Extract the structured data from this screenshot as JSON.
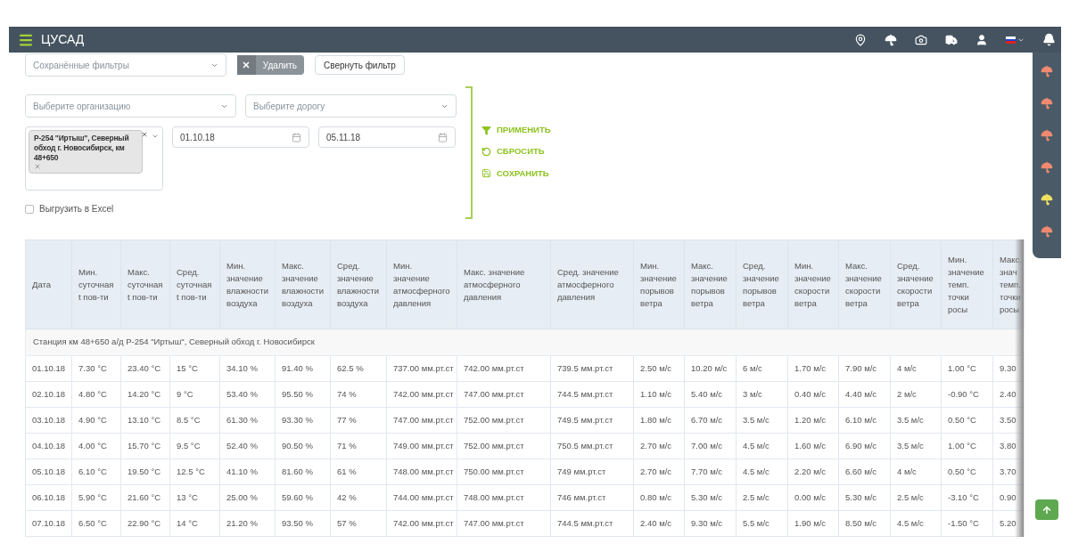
{
  "header": {
    "title": "ЦУСАД"
  },
  "alerts": [
    {
      "color": "#f08a70"
    },
    {
      "color": "#f08a70"
    },
    {
      "color": "#f08a70"
    },
    {
      "color": "#f08a70"
    },
    {
      "color": "#f0e060"
    },
    {
      "color": "#f08a70"
    }
  ],
  "saved_filters": {
    "placeholder": "Сохранённые фильтры"
  },
  "delete_button": "Удалить",
  "collapse_button": "Свернуть фильтр",
  "organization": {
    "placeholder": "Выберите организацию"
  },
  "road": {
    "placeholder": "Выберите дорогу"
  },
  "station_tag": "Р-254 \"Иртыш\", Северный обход г. Новосибирск, км 48+650",
  "date_from": "01.10.18",
  "date_to": "05.11.18",
  "actions": [
    {
      "kind": "apply",
      "label": "ПРИМЕНИТЬ"
    },
    {
      "kind": "reset",
      "label": "СБРОСИТЬ"
    },
    {
      "kind": "save",
      "label": "СОХРАНИТЬ"
    }
  ],
  "export_excel": {
    "label": "Выгрузить в Excel",
    "checked": false
  },
  "table": {
    "columns": [
      "Дата",
      "Мин. суточная t пов-ти",
      "Макс. суточная t пов-ти",
      "Сред. суточная t пов-ти",
      "Мин. значение влажности воздуха",
      "Макс. значение влажности воздуха",
      "Сред. значение влажности воздуха",
      "Мин. значение атмосферного давления",
      "Макс. значение атмосферного давления",
      "Сред. значение атмосферного давления",
      "Мин. значение порывов ветра",
      "Макс. значение порывов ветра",
      "Сред. значение порывов ветра",
      "Мин. значение скорости ветра",
      "Макс. значение скорости ветра",
      "Сред. значение скорости ветра",
      "Мин. значение темп. точки росы",
      "Макс. знач темп. точки росы"
    ],
    "group": "Станция км 48+650 а/д Р-254 \"Иртыш\", Северный обход г. Новосибирск",
    "rows": [
      [
        "01.10.18",
        "7.30 °C",
        "23.40 °C",
        "15 °C",
        "34.10 %",
        "91.40 %",
        "62.5 %",
        "737.00 мм.рт.ст",
        "742.00 мм.рт.ст",
        "739.5 мм.рт.ст",
        "2.50 м/с",
        "10.20 м/с",
        "6 м/с",
        "1.70 м/с",
        "7.90 м/с",
        "4 м/с",
        "1.00 °C",
        "9.30"
      ],
      [
        "02.10.18",
        "4.80 °C",
        "14.20 °C",
        "9 °C",
        "53.40 %",
        "95.50 %",
        "74 %",
        "742.00 мм.рт.ст",
        "747.00 мм.рт.ст",
        "744.5 мм.рт.ст",
        "1.10 м/с",
        "5.40 м/с",
        "3 м/с",
        "0.40 м/с",
        "4.40 м/с",
        "2 м/с",
        "-0.90 °C",
        "2.40"
      ],
      [
        "03.10.18",
        "4.90 °C",
        "13.10 °C",
        "8.5 °C",
        "61.30 %",
        "93.30 %",
        "77 %",
        "747.00 мм.рт.ст",
        "752.00 мм.рт.ст",
        "749.5 мм.рт.ст",
        "1.80 м/с",
        "6.70 м/с",
        "3.5 м/с",
        "1.20 м/с",
        "6.10 м/с",
        "3.5 м/с",
        "0.50 °C",
        "3.50"
      ],
      [
        "04.10.18",
        "4.00 °C",
        "15.70 °C",
        "9.5 °C",
        "52.40 %",
        "90.50 %",
        "71 %",
        "749.00 мм.рт.ст",
        "752.00 мм.рт.ст",
        "750.5 мм.рт.ст",
        "2.70 м/с",
        "7.00 м/с",
        "4.5 м/с",
        "1.60 м/с",
        "6.90 м/с",
        "3.5 м/с",
        "1.00 °C",
        "3.80"
      ],
      [
        "05.10.18",
        "6.10 °C",
        "19.50 °C",
        "12.5 °C",
        "41.10 %",
        "81.60 %",
        "61 %",
        "748.00 мм.рт.ст",
        "750.00 мм.рт.ст",
        "749 мм.рт.ст",
        "2.70 м/с",
        "7.70 м/с",
        "4.5 м/с",
        "2.20 м/с",
        "6.60 м/с",
        "4 м/с",
        "0.50 °C",
        "3.70"
      ],
      [
        "06.10.18",
        "5.90 °C",
        "21.60 °C",
        "13 °C",
        "25.00 %",
        "59.60 %",
        "42 %",
        "744.00 мм.рт.ст",
        "748.00 мм.рт.ст",
        "746 мм.рт.ст",
        "0.80 м/с",
        "5.30 м/с",
        "2.5 м/с",
        "0.00 м/с",
        "5.30 м/с",
        "2.5 м/с",
        "-3.10 °C",
        "0.90"
      ],
      [
        "07.10.18",
        "6.50 °C",
        "22.90 °C",
        "14 °C",
        "21.20 %",
        "93.50 %",
        "57 %",
        "742.00 мм.рт.ст",
        "747.00 мм.рт.ст",
        "744.5 мм.рт.ст",
        "2.40 м/с",
        "9.30 м/с",
        "5.5 м/с",
        "1.90 м/с",
        "8.50 м/с",
        "4.5 м/с",
        "-1.50 °C",
        "5.20"
      ]
    ]
  }
}
